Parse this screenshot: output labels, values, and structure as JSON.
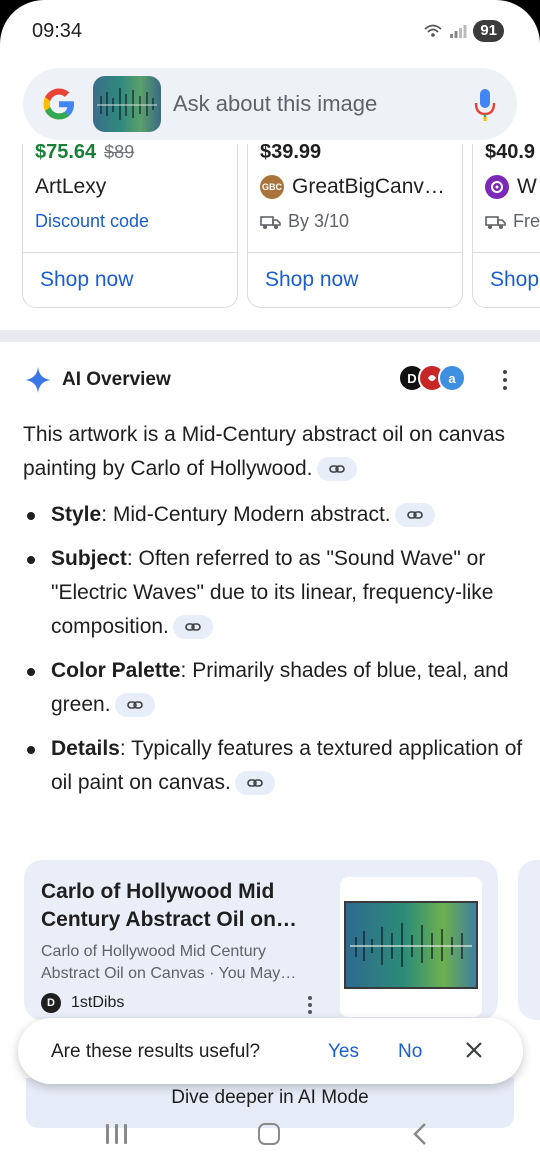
{
  "status_bar": {
    "time": "09:34",
    "battery": "91"
  },
  "search": {
    "placeholder": "Ask about this image"
  },
  "shopping": {
    "cards": [
      {
        "price": "$75.64",
        "old_price": "$89",
        "seller": "ArtLexy",
        "detail": "Discount code",
        "cta": "Shop now"
      },
      {
        "price": "$39.99",
        "seller_badge": "GBC",
        "seller": "GreatBigCanv…",
        "detail": "By 3/10",
        "cta": "Shop now"
      },
      {
        "price": "$40.9",
        "seller": "W",
        "detail": "Fre",
        "cta": "Shop"
      }
    ]
  },
  "ai_overview": {
    "title": "AI Overview",
    "intro": "This artwork is a Mid-Century abstract oil on canvas painting by Carlo of Hollywood.",
    "bullets": [
      {
        "label": "Style",
        "text": ": Mid-Century Modern abstract."
      },
      {
        "label": "Subject",
        "text": ": Often referred to as \"Sound Wave\" or \"Electric Waves\" due to its linear, frequency-like composition."
      },
      {
        "label": "Color Palette",
        "text": ": Primarily shades of blue, teal, and green."
      },
      {
        "label": "Details",
        "text": ": Typically features a textured application of oil paint on canvas."
      }
    ],
    "source_card": {
      "title": "Carlo of Hollywood Mid Century Abstract Oil on…",
      "description": "Carlo of Hollywood Mid Century Abstract Oil on Canvas · You May…",
      "site_badge": "D",
      "site": "1stDibs"
    }
  },
  "feedback": {
    "question": "Are these results useful?",
    "yes": "Yes",
    "no": "No"
  },
  "dive_deeper": "Dive deeper in AI Mode",
  "colors": {
    "link_blue": "#1a5fd0",
    "price_green": "#188038",
    "ai_card_bg": "#e9eef8"
  }
}
